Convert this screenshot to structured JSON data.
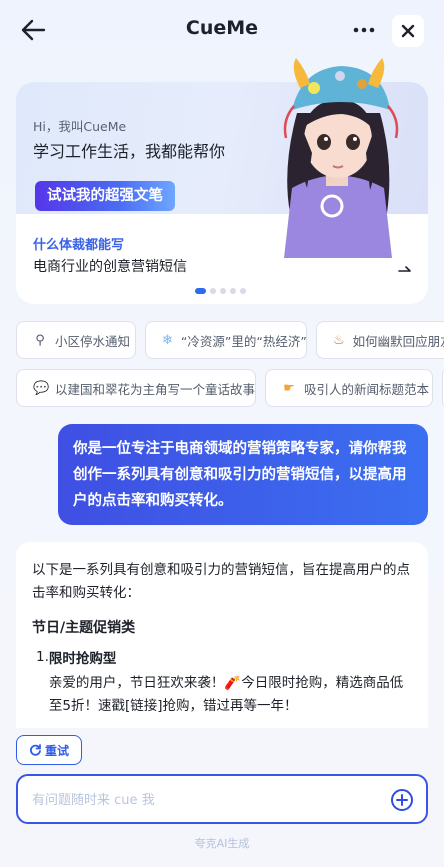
{
  "header": {
    "title": "CueMe"
  },
  "banner": {
    "greeting": "Hi，我叫CueMe",
    "headline": "学习工作生活，我都能帮你",
    "cta_label": "试试我的超强文笔",
    "genre_label": "什么体裁都能写",
    "genre_value": "电商行业的创意营销短信",
    "page_index": 1,
    "page_count": 5
  },
  "chips": [
    {
      "icon": "faucet-icon",
      "label": "小区停水通知"
    },
    {
      "icon": "snowflake-icon",
      "label": "“冷资源”里的“热经济”"
    },
    {
      "icon": "cupcake-icon",
      "label": "如何幽默回应朋友"
    },
    {
      "icon": "speech-bubble-icon",
      "label": "以建国和翠花为主角写一个童话故事"
    },
    {
      "icon": "pointing-hand-icon",
      "label": "吸引人的新闻标题范本"
    }
  ],
  "user_message": "你是一位专注于电商领域的营销策略专家，请你帮我创作一系列具有创意和吸引力的营销短信，以提高用户的点击率和购买转化。",
  "answer": {
    "intro": "以下是一系列具有创意和吸引力的营销短信，旨在提高用户的点击率和购买转化：",
    "section_title": "节日/主题促销类",
    "items": [
      {
        "number": "1.",
        "title": "限时抢购型",
        "body": "亲爱的用户，节日狂欢来袭！🧨今日限时抢购，精选商品低至5折！速戳[链接]抢购，错过再等一年！"
      }
    ]
  },
  "retry_label": "重试",
  "input": {
    "placeholder": "有问题随时来 cue 我",
    "value": ""
  },
  "footer": "夸克AI生成",
  "colors": {
    "accent": "#3a55e6",
    "bubble_start": "#3f4fe3",
    "bubble_end": "#3b6ff1"
  }
}
